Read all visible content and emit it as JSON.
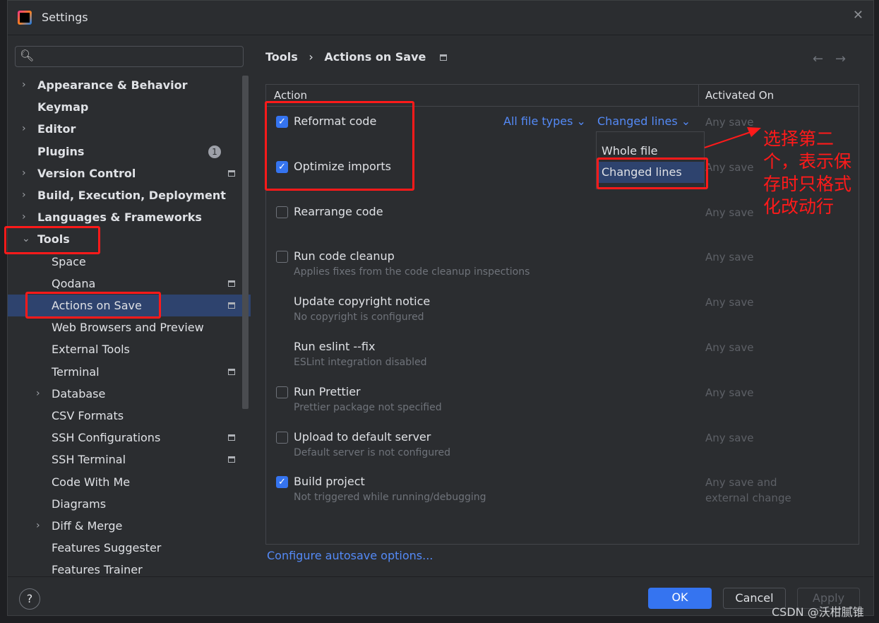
{
  "window": {
    "title": "Settings",
    "close": "✕"
  },
  "search": {
    "icon": "🔍︎",
    "placeholder": ""
  },
  "sidebar": {
    "items": [
      {
        "label": "Appearance & Behavior",
        "level": 0,
        "chevron": "›"
      },
      {
        "label": "Keymap",
        "level": 0
      },
      {
        "label": "Editor",
        "level": 0,
        "chevron": "›"
      },
      {
        "label": "Plugins",
        "level": 0,
        "badge": "1"
      },
      {
        "label": "Version Control",
        "level": 0,
        "chevron": "›",
        "pin": true
      },
      {
        "label": "Build, Execution, Deployment",
        "level": 0,
        "chevron": "›"
      },
      {
        "label": "Languages & Frameworks",
        "level": 0,
        "chevron": "›"
      },
      {
        "label": "Tools",
        "level": 0,
        "chevron": "⌄",
        "bold": true
      },
      {
        "label": "Space",
        "level": 1
      },
      {
        "label": "Qodana",
        "level": 1,
        "pin": true
      },
      {
        "label": "Actions on Save",
        "level": 1,
        "pin": true,
        "selected": true
      },
      {
        "label": "Web Browsers and Preview",
        "level": 1
      },
      {
        "label": "External Tools",
        "level": 1
      },
      {
        "label": "Terminal",
        "level": 1,
        "pin": true
      },
      {
        "label": "Database",
        "level": 1,
        "chevron": "›"
      },
      {
        "label": "CSV Formats",
        "level": 1
      },
      {
        "label": "SSH Configurations",
        "level": 1,
        "pin": true
      },
      {
        "label": "SSH Terminal",
        "level": 1,
        "pin": true
      },
      {
        "label": "Code With Me",
        "level": 1
      },
      {
        "label": "Diagrams",
        "level": 1
      },
      {
        "label": "Diff & Merge",
        "level": 1,
        "chevron": "›"
      },
      {
        "label": "Features Suggester",
        "level": 1
      },
      {
        "label": "Features Trainer",
        "level": 1
      }
    ]
  },
  "breadcrumb": {
    "parent": "Tools",
    "sep": "›",
    "current": "Actions on Save",
    "back": "←",
    "forward": "→"
  },
  "table": {
    "headers": {
      "action": "Action",
      "activated": "Activated On"
    },
    "rows": [
      {
        "label": "Reformat code",
        "checked": true,
        "activated": "Any save",
        "file_types": "All file types",
        "scope": "Changed lines"
      },
      {
        "label": "Optimize imports",
        "checked": true,
        "activated": "Any save"
      },
      {
        "label": "Rearrange code",
        "checked": false,
        "activated": "Any save"
      },
      {
        "label": "Run code cleanup",
        "checked": false,
        "sub": "Applies fixes from the code cleanup inspections",
        "activated": "Any save"
      },
      {
        "label": "Update copyright notice",
        "sub": "No copyright is configured",
        "activated": "Any save"
      },
      {
        "label": "Run eslint --fix",
        "sub": "ESLint integration disabled",
        "activated": "Any save"
      },
      {
        "label": "Run Prettier",
        "checked": false,
        "sub": "Prettier package not specified",
        "activated": "Any save"
      },
      {
        "label": "Upload to default server",
        "checked": false,
        "sub": "Default server is not configured",
        "activated": "Any save"
      },
      {
        "label": "Build project",
        "checked": true,
        "sub": "Not triggered while running/debugging",
        "activated": "Any save and\nexternal change"
      }
    ]
  },
  "dropdown": {
    "options": [
      "Whole file",
      "Changed lines"
    ],
    "selected": "Changed lines"
  },
  "annotation": "选择第二个，表示保存时只格式化改动行",
  "configure_link": "Configure autosave options...",
  "help": "?",
  "buttons": {
    "ok": "OK",
    "cancel": "Cancel",
    "apply": "Apply"
  },
  "watermark": "CSDN @沃柑腻锥",
  "colors": {
    "accent": "#3574f0",
    "link": "#548af7",
    "selection": "#2e436e",
    "annotation": "#ff1a1a"
  }
}
